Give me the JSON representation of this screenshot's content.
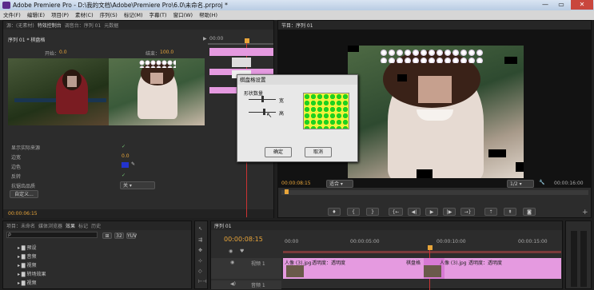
{
  "window": {
    "title": "Adobe Premiere Pro - D:\\我的文档\\Adobe\\Premiere Pro\\6.0\\未命名.prproj *"
  },
  "menu": [
    "文件(F)",
    "编辑(E)",
    "项目(P)",
    "素材(C)",
    "序列(S)",
    "标记(M)",
    "字幕(T)",
    "窗口(W)",
    "帮助(H)"
  ],
  "source_panel": {
    "tabs": [
      "源：(无素材)",
      "特效控制台",
      "调音台：序列 01",
      "元数据"
    ],
    "header": "序列 01 * 棋盘格",
    "start_label": "开始：",
    "start_value": "0.0",
    "end_label": "结束：",
    "end_value": "100.0"
  },
  "effect_props": {
    "show_source": "显示实际来源",
    "border_width_label": "边宽",
    "border_width_value": "0.0",
    "border_color_label": "边色",
    "reverse_label": "反转",
    "antialias_label": "抗锯齿品质",
    "antialias_value": "关",
    "custom_button": "自定义...",
    "timecode": "00:00:06:15",
    "mini_timecode": "00:00"
  },
  "dialog": {
    "title": "棋盘格设置",
    "group_label": "形状数量",
    "wide_label": "宽",
    "high_label": "高",
    "ok": "确定",
    "cancel": "取消"
  },
  "program_panel": {
    "tab": "节目：序列 01",
    "timecode": "00:00:08:15",
    "fit": "适合",
    "quality": "1/2",
    "end_timecode": "00:00:16:00"
  },
  "project_panel": {
    "tabs": [
      "项目：未命名",
      "媒体浏览器",
      "效果",
      "标记",
      "历史"
    ],
    "search_placeholder": "",
    "tree": [
      "预设",
      "音频",
      "视频",
      "转场效果",
      "视频"
    ]
  },
  "timeline": {
    "tab": "序列 01",
    "timecode": "00:00:08:15",
    "ruler": [
      "00:00",
      "00:00:05:00",
      "00:00:10:00",
      "00:00:15:00"
    ],
    "video_track": "视频 1",
    "audio_track": "音频 1",
    "clip_labels": [
      "人像 (3).jpg",
      "透明度：透明度",
      "棋盘格",
      "人像 (3).jpg",
      "透明度：透明度"
    ]
  },
  "colors": {
    "accent": "#e8a53a",
    "clip_pink": "#e59ae0",
    "dialog_bg": "#e8e8e8"
  }
}
